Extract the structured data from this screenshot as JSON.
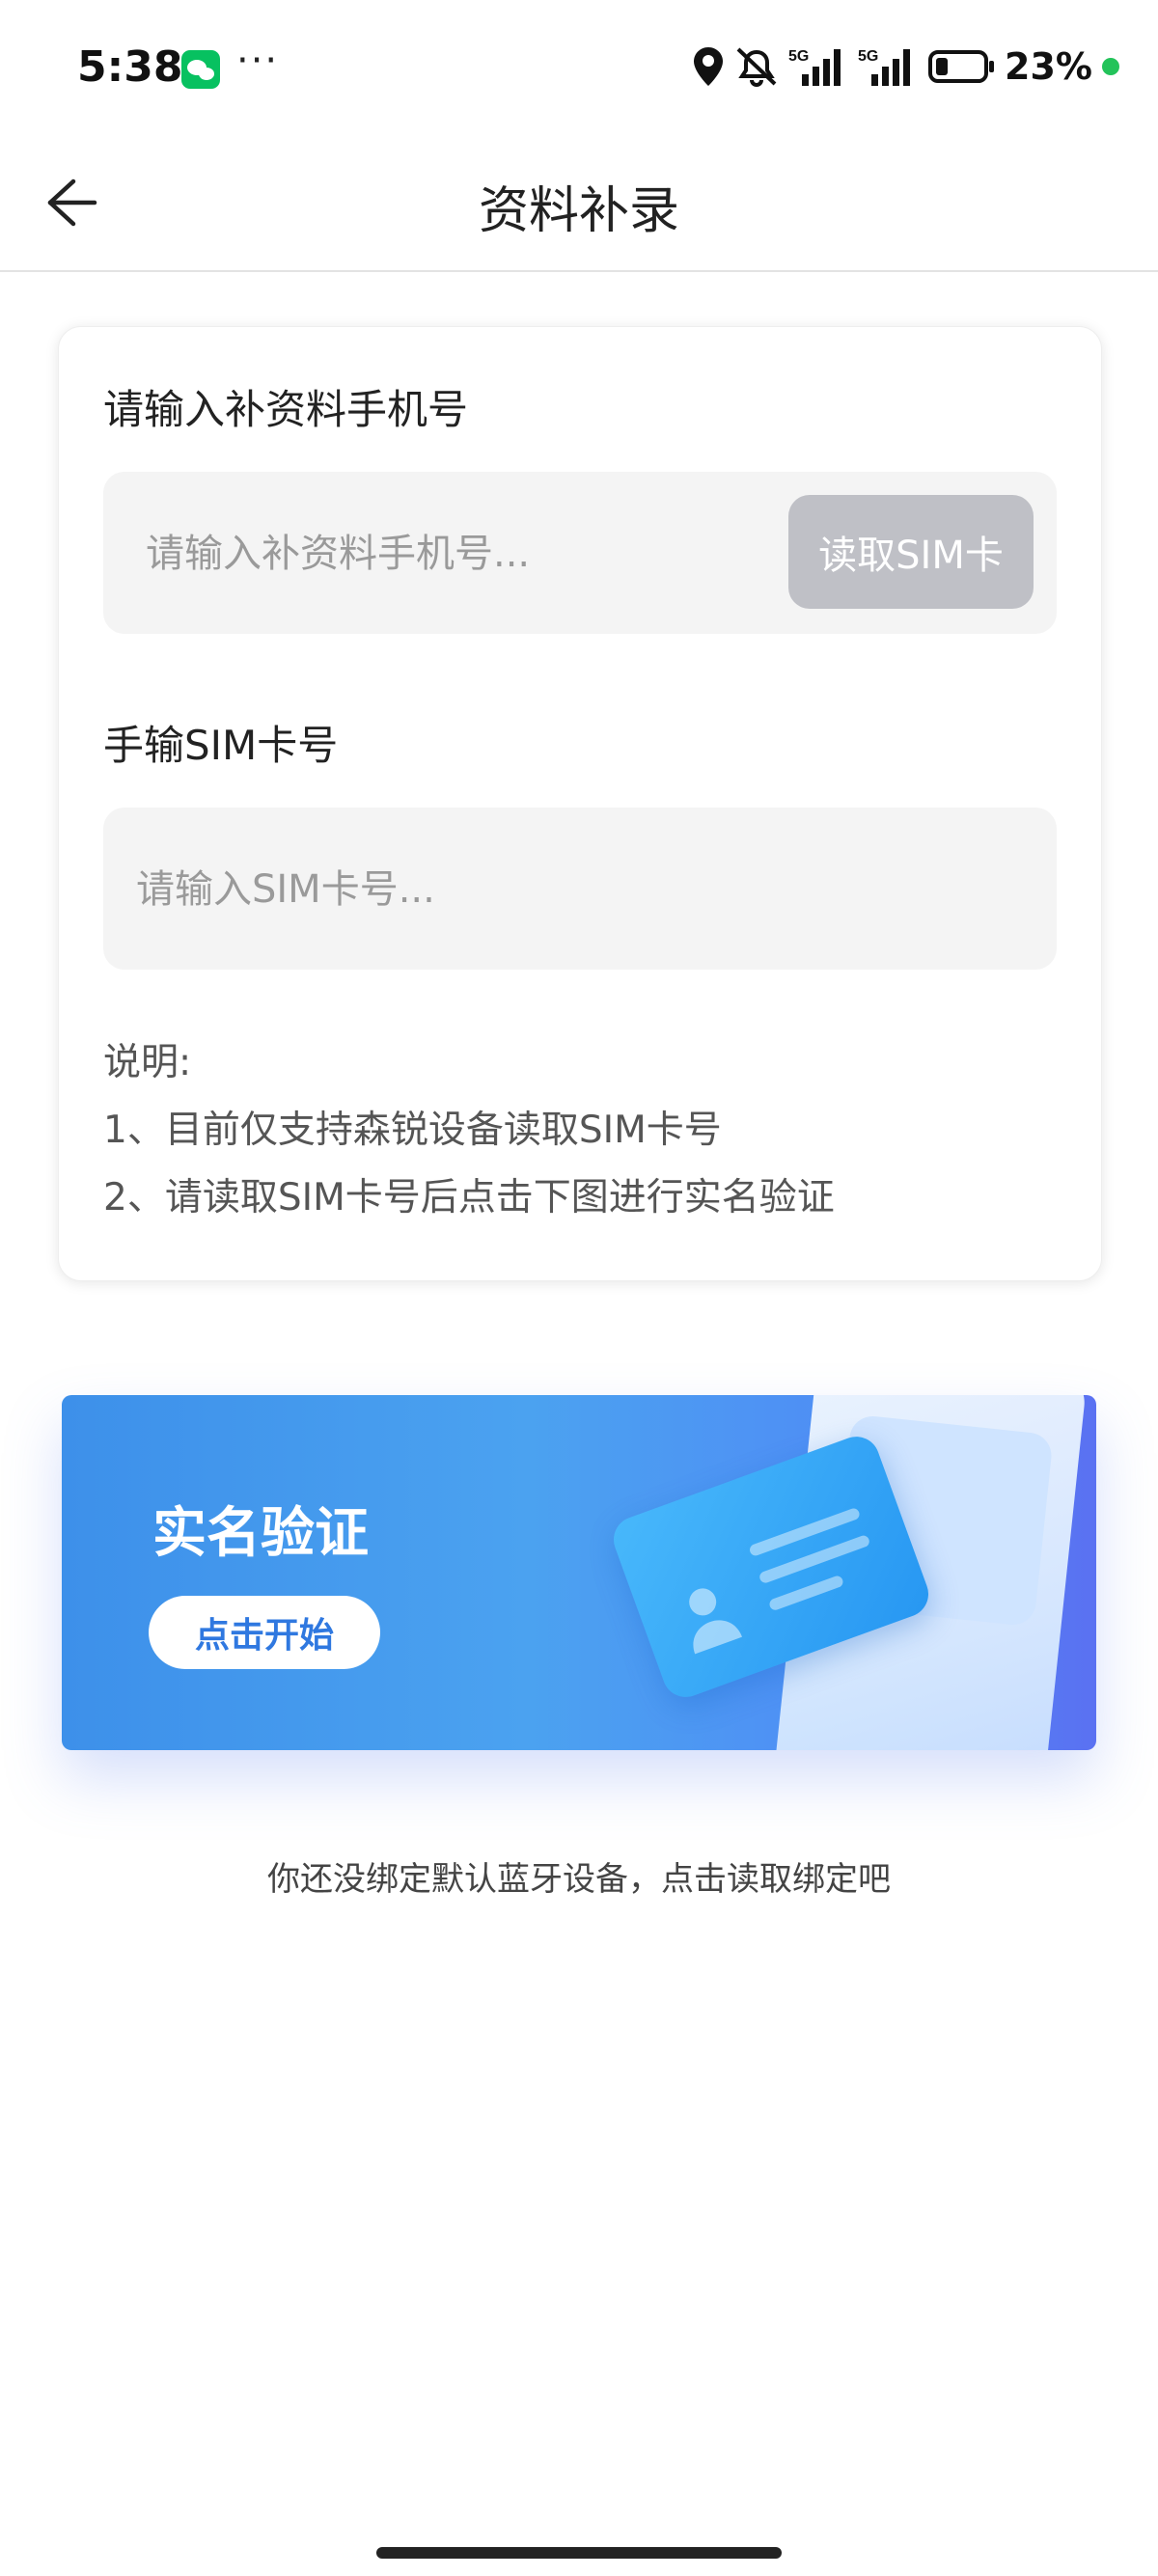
{
  "status_bar": {
    "time": "5:38",
    "more": "···",
    "battery_percent": "23%",
    "icons": [
      "wechat-icon",
      "location-icon",
      "mute-icon",
      "signal-5g-icon",
      "signal-5g-icon",
      "battery-icon"
    ]
  },
  "nav": {
    "title": "资料补录"
  },
  "form": {
    "phone_label": "请输入补资料手机号",
    "phone_placeholder": "请输入补资料手机号...",
    "read_sim_button": "读取SIM卡",
    "sim_label": "手输SIM卡号",
    "sim_placeholder": "请输入SIM卡号...",
    "notes": {
      "title": "说明:",
      "items": [
        "1、目前仅支持森锐设备读取SIM卡号",
        "2、请读取SIM卡号后点击下图进行实名验证"
      ]
    }
  },
  "banner": {
    "title": "实名验证",
    "button": "点击开始"
  },
  "hint": "你还没绑定默认蓝牙设备，点击读取绑定吧",
  "colors": {
    "accent": "#2f78e0",
    "banner_start": "#3d90ea",
    "banner_end": "#5a71f2",
    "button_disabled": "#bfc0c6"
  }
}
